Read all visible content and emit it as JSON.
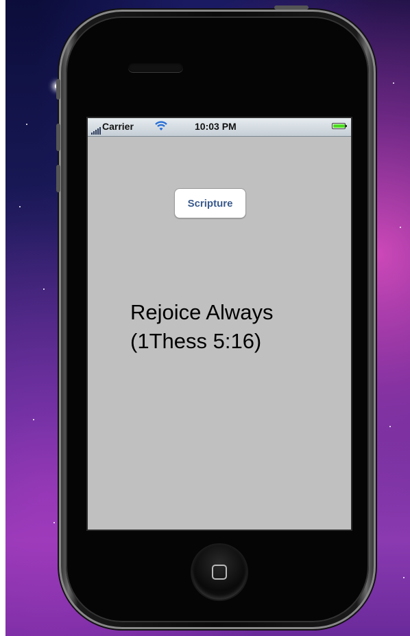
{
  "status_bar": {
    "carrier": "Carrier",
    "time": "10:03 PM",
    "signal_icon": "signal-bars-icon",
    "wifi_icon": "wifi-icon",
    "battery_icon": "battery-icon",
    "battery_level": 1.0
  },
  "app": {
    "button_label": "Scripture",
    "verse_line1": "Rejoice Always",
    "verse_line2": "(1Thess 5:16)"
  },
  "device": {
    "home_button_icon": "home-square-icon"
  },
  "colors": {
    "screen_bg": "#c0c0c0",
    "button_text": "#3a5a8c",
    "battery_fill": "#4ddc22"
  }
}
